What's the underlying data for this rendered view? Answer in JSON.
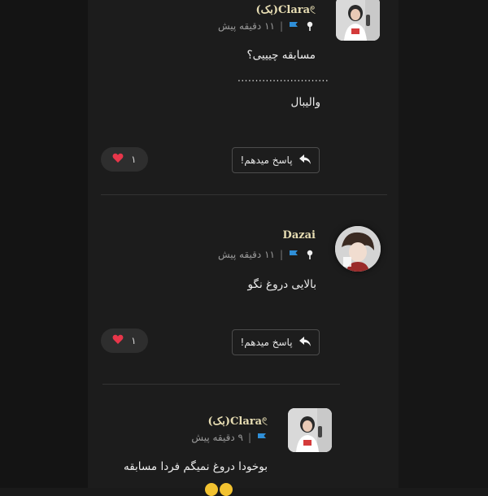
{
  "comments": [
    {
      "username": "Clara𓏲(بک)",
      "time_ago": "۱۱ دقیقه پیش",
      "text_lines": [
        "مسابقه چیییی؟",
        "..........................",
        "والیبال"
      ],
      "reply_label": "پاسخ میدهم!",
      "likes": "۱"
    },
    {
      "username": "Dazai",
      "time_ago": "۱۱ دقیقه پیش",
      "text_lines": [
        "بالایی دروغ نگو"
      ],
      "reply_label": "پاسخ میدهم!",
      "likes": "۱"
    },
    {
      "username": "Clara𓏲(بک)",
      "time_ago": "۹ دقیقه پیش",
      "text_lines": [
        "بوخودا دروغ نمیگم فردا مسابقه"
      ]
    }
  ],
  "icons": {
    "pin": "pin-icon",
    "flag": "flag-icon",
    "reply": "reply-arrow-icon",
    "heart": "heart-icon"
  },
  "colors": {
    "username": "#e7ddb3",
    "flag": "#2f8fd8",
    "heart": "#e8364a",
    "background": "#1c1c1c"
  }
}
